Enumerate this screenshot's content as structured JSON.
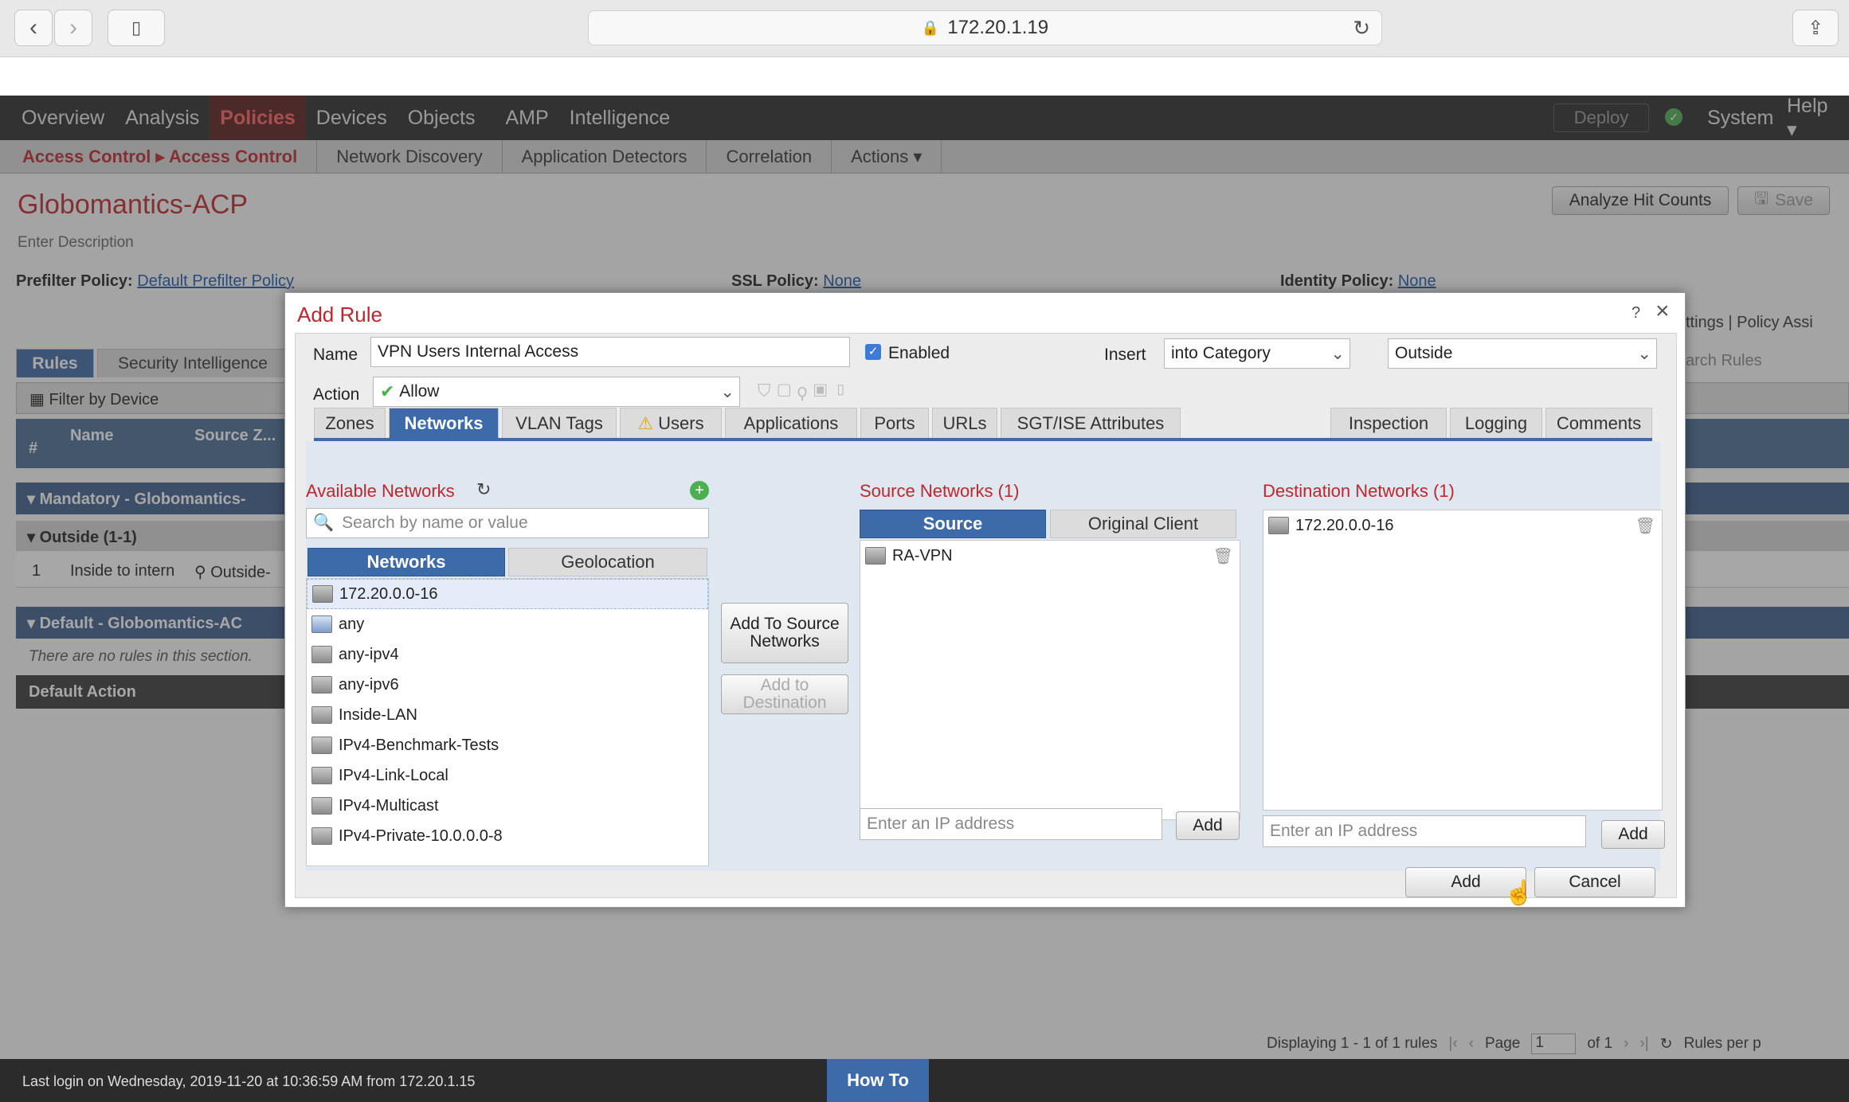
{
  "browser": {
    "url": "172.20.1.19"
  },
  "topnav": {
    "items": [
      "Overview",
      "Analysis",
      "Policies",
      "Devices",
      "Objects",
      "AMP",
      "Intelligence"
    ],
    "deploy": "Deploy",
    "system": "System",
    "help": "Help ▾"
  },
  "subnav": {
    "breadcrumb": "Access Control ▸ Access Control",
    "items": [
      "Network Discovery",
      "Application Detectors",
      "Correlation",
      "Actions ▾"
    ]
  },
  "page": {
    "title": "Globomantics-ACP",
    "description": "Enter Description",
    "analyze_btn": "Analyze Hit Counts",
    "save_btn": "Save",
    "prefilter_label": "Prefilter Policy:",
    "prefilter_value": "Default Prefilter Policy",
    "ssl_label": "SSL Policy:",
    "ssl_value": "None",
    "identity_label": "Identity Policy:",
    "identity_value": "None",
    "right_links": "ttings | ",
    "policy_assign": "Policy Assi",
    "search_rules": "arch Rules"
  },
  "rules": {
    "tabs": [
      "Rules",
      "Security Intelligence"
    ],
    "filter": "Filter by Device",
    "col_hash": "#",
    "col_name": "Name",
    "col_source": "Source Z...",
    "mandatory": "Mandatory - Globomantics-",
    "outside": "Outside (1-1)",
    "row_num": "1",
    "row_name": "Inside to intern",
    "row_src": "Outside-",
    "default_section": "Default - Globomantics-AC",
    "no_rules": "There are no rules in this section.",
    "default_action": "Default Action"
  },
  "dialog": {
    "title": "Add Rule",
    "help": "?",
    "close": "×",
    "name_label": "Name",
    "name_value": "VPN Users Internal Access",
    "enabled_label": "Enabled",
    "insert_label": "Insert",
    "insert_value": "into Category",
    "category_value": "Outside",
    "action_label": "Action",
    "action_value": "Allow",
    "tabs": [
      "Zones",
      "Networks",
      "VLAN Tags",
      "Users",
      "Applications",
      "Ports",
      "URLs",
      "SGT/ISE Attributes"
    ],
    "right_tabs": [
      "Inspection",
      "Logging",
      "Comments"
    ],
    "available_label": "Available Networks",
    "search_placeholder": "Search by name or value",
    "avail_tabs": [
      "Networks",
      "Geolocation"
    ],
    "networks": [
      "172.20.0.0-16",
      "any",
      "any-ipv4",
      "any-ipv6",
      "Inside-LAN",
      "IPv4-Benchmark-Tests",
      "IPv4-Link-Local",
      "IPv4-Multicast",
      "IPv4-Private-10.0.0.0-8"
    ],
    "add_source": "Add To Source Networks",
    "add_dest": "Add to Destination",
    "source_label": "Source Networks (1)",
    "source_tabs": [
      "Source",
      "Original Client"
    ],
    "source_items": [
      "RA-VPN"
    ],
    "dest_label": "Destination Networks (1)",
    "dest_items": [
      "172.20.0.0-16"
    ],
    "ip_placeholder": "Enter an IP address",
    "add_small": "Add",
    "add_btn": "Add",
    "cancel_btn": "Cancel"
  },
  "pager": {
    "displaying": "Displaying 1 - 1 of 1 rules",
    "page_label": "Page",
    "page_value": "1",
    "of": "of 1",
    "rules_per": "Rules per p"
  },
  "footer": {
    "last_login": "Last login on Wednesday, 2019-11-20 at 10:36:59 AM from 172.20.1.15",
    "howto": "How To"
  }
}
